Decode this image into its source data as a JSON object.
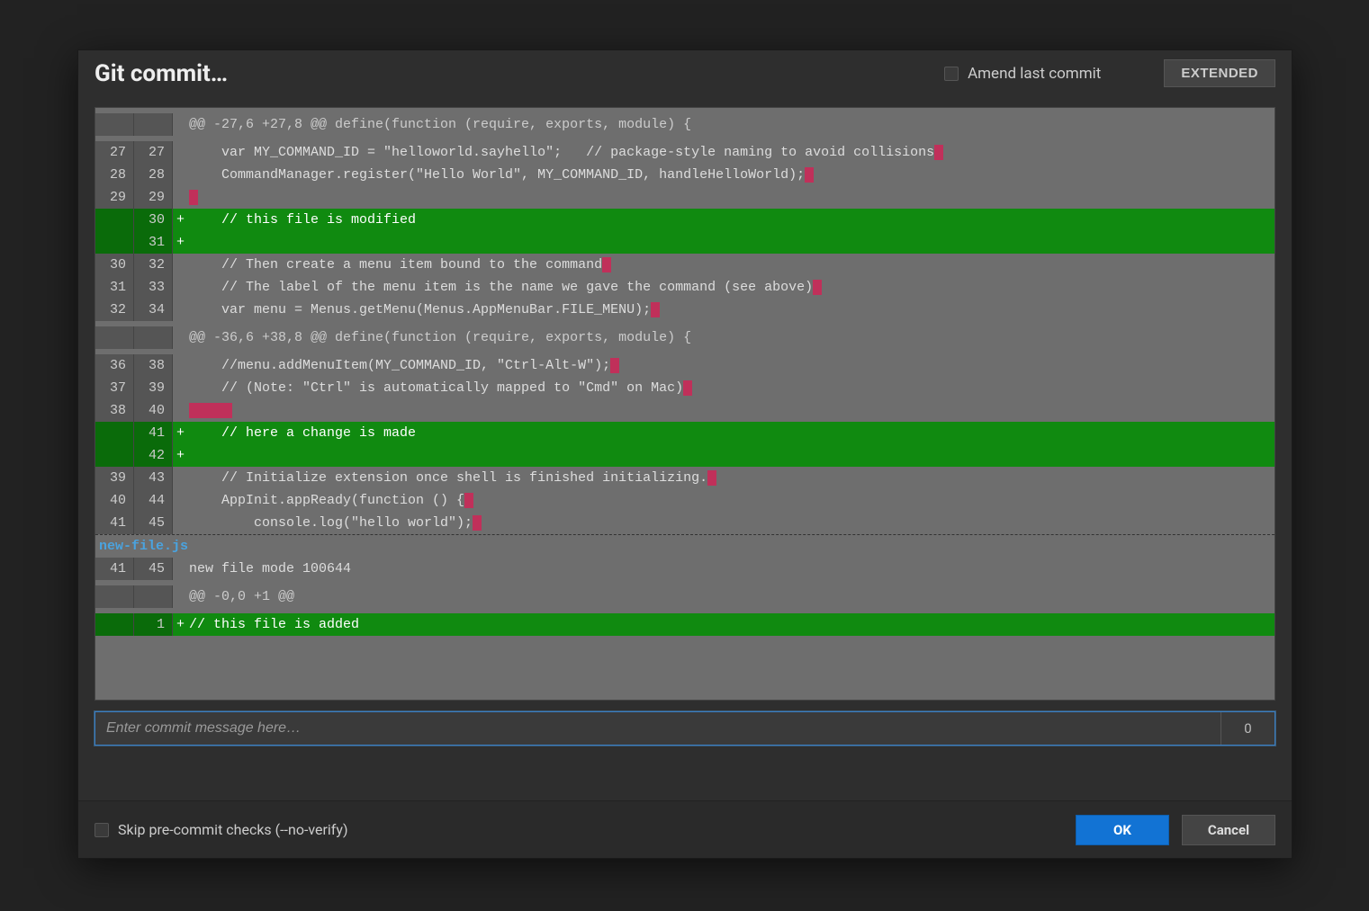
{
  "header": {
    "title": "Git commit…",
    "amend_label": "Amend last commit",
    "extended_label": "EXTENDED"
  },
  "commit_input": {
    "placeholder": "Enter commit message here…",
    "char_count": "0"
  },
  "footer": {
    "skip_label": "Skip pre-commit checks (--no-verify)",
    "ok_label": "OK",
    "cancel_label": "Cancel"
  },
  "files": [
    {
      "name": null,
      "lines": [
        {
          "t": "hunk",
          "a": "",
          "b": "",
          "m": "",
          "code": "@@ -27,6 +27,8 @@ define(function (require, exports, module) {"
        },
        {
          "t": "ctx",
          "a": "27",
          "b": "27",
          "m": "",
          "code": "    var MY_COMMAND_ID = \"helloworld.sayhello\";   // package-style naming to avoid collisions",
          "trail": 1
        },
        {
          "t": "ctx",
          "a": "28",
          "b": "28",
          "m": "",
          "code": "    CommandManager.register(\"Hello World\", MY_COMMAND_ID, handleHelloWorld);",
          "trail": 1
        },
        {
          "t": "ctx",
          "a": "29",
          "b": "29",
          "m": "",
          "code": "",
          "trail": 1
        },
        {
          "t": "add",
          "a": "",
          "b": "30",
          "m": "+",
          "code": "    // this file is modified"
        },
        {
          "t": "add",
          "a": "",
          "b": "31",
          "m": "+",
          "code": ""
        },
        {
          "t": "ctx",
          "a": "30",
          "b": "32",
          "m": "",
          "code": "    // Then create a menu item bound to the command",
          "trail": 1
        },
        {
          "t": "ctx",
          "a": "31",
          "b": "33",
          "m": "",
          "code": "    // The label of the menu item is the name we gave the command (see above)",
          "trail": 1
        },
        {
          "t": "ctx",
          "a": "32",
          "b": "34",
          "m": "",
          "code": "    var menu = Menus.getMenu(Menus.AppMenuBar.FILE_MENU);",
          "trail": 1
        },
        {
          "t": "hunk",
          "a": "",
          "b": "",
          "m": "",
          "code": "@@ -36,6 +38,8 @@ define(function (require, exports, module) {"
        },
        {
          "t": "ctx",
          "a": "36",
          "b": "38",
          "m": "",
          "code": "    //menu.addMenuItem(MY_COMMAND_ID, \"Ctrl-Alt-W\");",
          "trail": 1
        },
        {
          "t": "ctx",
          "a": "37",
          "b": "39",
          "m": "",
          "code": "    // (Note: \"Ctrl\" is automatically mapped to \"Cmd\" on Mac)",
          "trail": 1
        },
        {
          "t": "ctx",
          "a": "38",
          "b": "40",
          "m": "",
          "code": "",
          "trail": 5
        },
        {
          "t": "add",
          "a": "",
          "b": "41",
          "m": "+",
          "code": "    // here a change is made"
        },
        {
          "t": "add",
          "a": "",
          "b": "42",
          "m": "+",
          "code": ""
        },
        {
          "t": "ctx",
          "a": "39",
          "b": "43",
          "m": "",
          "code": "    // Initialize extension once shell is finished initializing.",
          "trail": 1
        },
        {
          "t": "ctx",
          "a": "40",
          "b": "44",
          "m": "",
          "code": "    AppInit.appReady(function () {",
          "trail": 1
        },
        {
          "t": "ctx",
          "a": "41",
          "b": "45",
          "m": "",
          "code": "        console.log(\"hello world\");",
          "trail": 1
        }
      ]
    },
    {
      "name": "new-file.js",
      "lines": [
        {
          "t": "ctx",
          "a": "41",
          "b": "45",
          "m": "",
          "code": "new file mode 100644"
        },
        {
          "t": "hunk",
          "a": "",
          "b": "",
          "m": "",
          "code": "@@ -0,0 +1 @@"
        },
        {
          "t": "add",
          "a": "",
          "b": "1",
          "m": "+",
          "code": "// this file is added"
        }
      ]
    }
  ]
}
